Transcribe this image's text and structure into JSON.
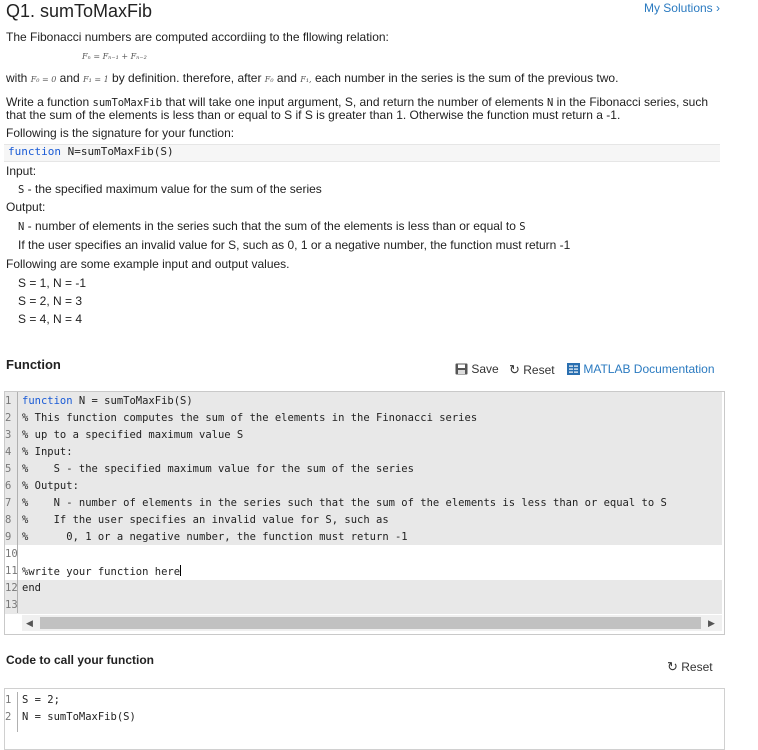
{
  "header": {
    "title": "Q1. sumToMaxFib",
    "my_solutions": "My Solutions ›"
  },
  "description": {
    "intro": "The Fibonacci numbers are computed accordiing to the fllowing relation:",
    "formula": "Fₙ = Fₙ₋₁ + Fₙ₋₂",
    "def_with": "with",
    "f0": "F₀ = 0",
    "and1": "and",
    "f1": "F₁ = 1",
    "def_mid": "by definition. therefore, after",
    "f0b": "F₀",
    "and2": "and",
    "f1b": "F₁,",
    "def_end": "each number in the series is the sum of the previous two.",
    "task_a": "Write a function",
    "task_fn": "sumToMaxFib",
    "task_b": "that will take one input argument, S, and return the number of elements",
    "task_n": "N",
    "task_c": "in the Fibonacci series, such",
    "task_line2": "that the sum of the elements is less than or equal to S if S is greater than 1. Otherwise the function must return a -1.",
    "signature_intro": "Following is the signature for your function:",
    "signature_kw": "function",
    "signature_rest": "N=sumToMaxFib(S)",
    "input_label": "Input:",
    "input_var": "S",
    "input_desc": "- the specified maximum value for the sum of the series",
    "output_label": "Output:",
    "output_var": "N",
    "output_desc": "- number of elements in the series such that the sum of the elements is less than or equal to",
    "output_var2": "S",
    "output_invalid": "If the user specifies an invalid value for S, such as 0, 1 or a negative number, the function must return -1",
    "examples_intro": "Following are some example input and output values.",
    "examples": [
      "S = 1, N = -1",
      "S = 2, N = 3",
      "S = 4, N = 4"
    ]
  },
  "function_section": {
    "heading": "Function",
    "save": "Save",
    "reset": "Reset",
    "docs": "MATLAB Documentation"
  },
  "editor": {
    "line_numbers": [
      "1",
      "2",
      "3",
      "4",
      "5",
      "6",
      "7",
      "8",
      "9",
      "10",
      "11",
      "12",
      "13"
    ],
    "line1_kw": "function",
    "line1_rest": " N = sumToMaxFib(S)",
    "comments": [
      "% This function computes the sum of the elements in the Finonacci series",
      "% up to a specified maximum value S",
      "% Input:",
      "%    S - the specified maximum value for the sum of the series",
      "% Output:",
      "%    N - number of elements in the series such that the sum of the elements is less than or equal to S",
      "%    If the user specifies an invalid value for S, such as",
      "%      0, 1 or a negative number, the function must return -1"
    ],
    "line11": "%write your function here",
    "line12": "end"
  },
  "call_section": {
    "heading": "Code to call your function",
    "reset": "Reset",
    "line_numbers": [
      "1",
      "2"
    ],
    "lines": [
      "S = 2;",
      "N = sumToMaxFib(S)"
    ]
  }
}
